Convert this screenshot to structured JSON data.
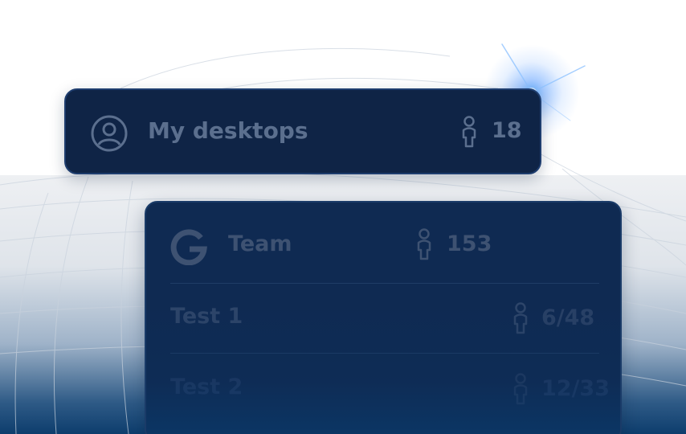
{
  "desktops_card": {
    "title": "My desktops",
    "count": "18",
    "icon": "user-circle-icon",
    "count_icon": "person-icon"
  },
  "team_card": {
    "icon": "google-g-icon",
    "title": "Team",
    "count": "153",
    "rows": [
      {
        "label": "Test 1",
        "count": "6/48"
      },
      {
        "label": "Test 2",
        "count": "12/33"
      }
    ]
  },
  "colors": {
    "card_bg": "#0f2446",
    "card_border": "#1e3d6e",
    "text_muted": "#5b6f8e",
    "accent_glow": "#3c8cff"
  }
}
